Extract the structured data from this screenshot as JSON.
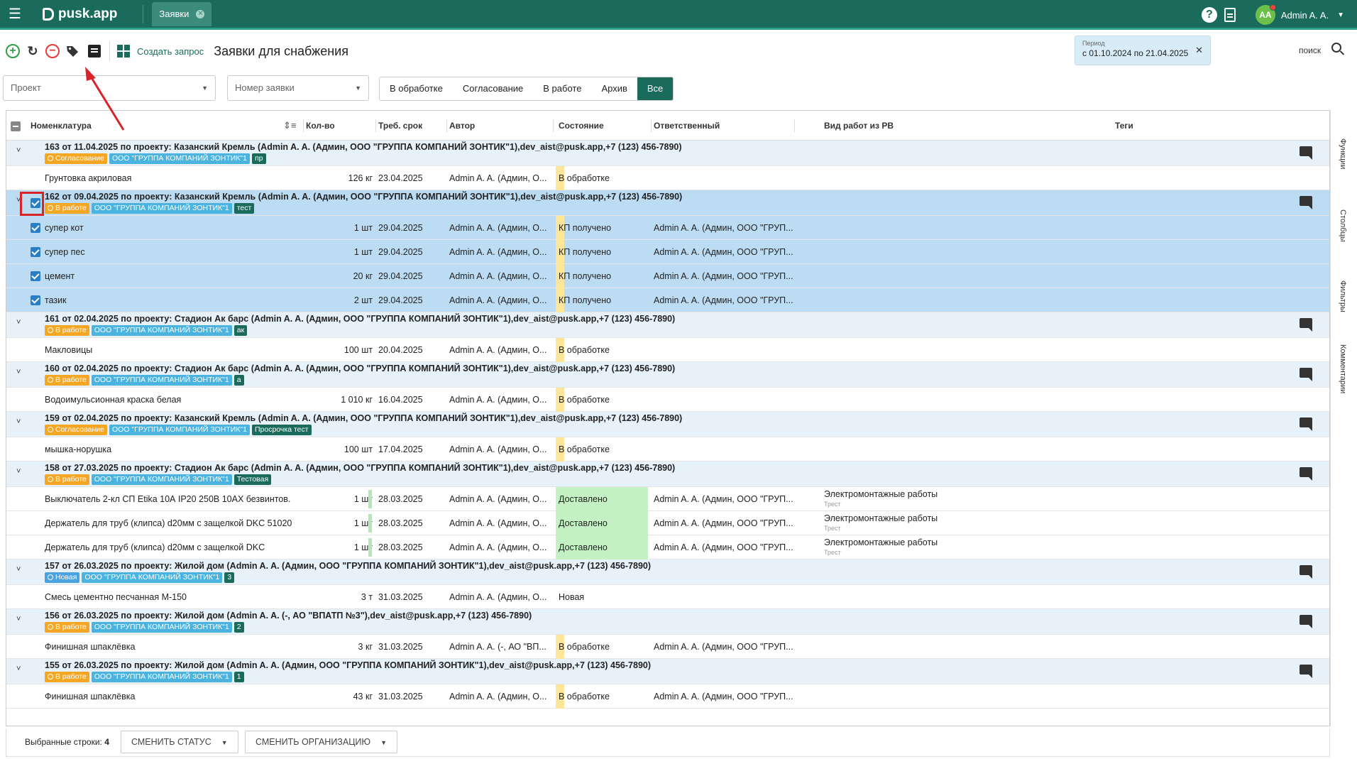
{
  "topbar": {
    "logo": "pusk.app",
    "tab": "Заявки",
    "avatar": "AA",
    "user": "Admin A. A."
  },
  "toolbar": {
    "create_label": "Создать запрос",
    "page_title": "Заявки для снабжения"
  },
  "period": {
    "label": "Период",
    "value": "с 01.10.2024 по 21.04.2025"
  },
  "search": {
    "label": "поиск"
  },
  "filters": {
    "project_placeholder": "Проект",
    "number_placeholder": "Номер заявки",
    "segments": [
      "В обработке",
      "Согласование",
      "В работе",
      "Архив",
      "Все"
    ],
    "active_segment": 4
  },
  "columns": {
    "name": "Номенклатура",
    "qty": "Кол-во",
    "due": "Треб. срок",
    "author": "Автор",
    "state": "Состояние",
    "resp": "Ответственный",
    "works": "Вид работ из РВ",
    "tags": "Теги"
  },
  "groups": [
    {
      "title": "163 от 11.04.2025 по проекту: Казанский Кремль (Admin A. A. (Админ, ООО \"ГРУППА КОМПАНИЙ ЗОНТИК\"1),dev_aist@pusk.app,+7 (123) 456-7890)",
      "status": "Согласование",
      "org": "ООО \"ГРУППА КОМПАНИЙ ЗОНТИК\"1",
      "tag": "пр"
    },
    {
      "title": "162 от 09.04.2025 по проекту: Казанский Кремль (Admin A. A. (Админ, ООО \"ГРУППА КОМПАНИЙ ЗОНТИК\"1),dev_aist@pusk.app,+7 (123) 456-7890)",
      "status": "В работе",
      "org": "ООО \"ГРУППА КОМПАНИЙ ЗОНТИК\"1",
      "tag": "тест"
    },
    {
      "title": "161 от 02.04.2025 по проекту: Стадион Ак барс (Admin A. A. (Админ, ООО \"ГРУППА КОМПАНИЙ ЗОНТИК\"1),dev_aist@pusk.app,+7 (123) 456-7890)",
      "status": "В работе",
      "org": "ООО \"ГРУППА КОМПАНИЙ ЗОНТИК\"1",
      "tag": "ак"
    },
    {
      "title": "160 от 02.04.2025 по проекту: Стадион Ак барс (Admin A. A. (Админ, ООО \"ГРУППА КОМПАНИЙ ЗОНТИК\"1),dev_aist@pusk.app,+7 (123) 456-7890)",
      "status": "В работе",
      "org": "ООО \"ГРУППА КОМПАНИЙ ЗОНТИК\"1",
      "tag": "а"
    },
    {
      "title": "159 от 02.04.2025 по проекту: Казанский Кремль (Admin A. A. (Админ, ООО \"ГРУППА КОМПАНИЙ ЗОНТИК\"1),dev_aist@pusk.app,+7 (123) 456-7890)",
      "status": "Согласование",
      "org": "ООО \"ГРУППА КОМПАНИЙ ЗОНТИК\"1",
      "tag": "Просрочка тест"
    },
    {
      "title": "158 от 27.03.2025 по проекту: Стадион Ак барс (Admin A. A. (Админ, ООО \"ГРУППА КОМПАНИЙ ЗОНТИК\"1),dev_aist@pusk.app,+7 (123) 456-7890)",
      "status": "В работе",
      "org": "ООО \"ГРУППА КОМПАНИЙ ЗОНТИК\"1",
      "tag": "Тестовая"
    },
    {
      "title": "157 от 26.03.2025 по проекту: Жилой дом (Admin A. A. (Админ, ООО \"ГРУППА КОМПАНИЙ ЗОНТИК\"1),dev_aist@pusk.app,+7 (123) 456-7890)",
      "status": "Новая",
      "org": "ООО \"ГРУППА КОМПАНИЙ ЗОНТИК\"1",
      "tag": "3"
    },
    {
      "title": "156 от 26.03.2025 по проекту: Жилой дом (Admin A. A. (-, АО \"ВПАТП №3\"),dev_aist@pusk.app,+7 (123) 456-7890)",
      "status": "В работе",
      "org": "ООО \"ГРУППА КОМПАНИЙ ЗОНТИК\"1",
      "tag": "2"
    },
    {
      "title": "155 от 26.03.2025 по проекту: Жилой дом (Admin A. A. (Админ, ООО \"ГРУППА КОМПАНИЙ ЗОНТИК\"1),dev_aist@pusk.app,+7 (123) 456-7890)",
      "status": "В работе",
      "org": "ООО \"ГРУППА КОМПАНИЙ ЗОНТИК\"1",
      "tag": "1"
    }
  ],
  "items": [
    {
      "name": "Грунтовка акриловая",
      "qty": "126 кг",
      "date": "23.04.2025",
      "author": "Admin A. A. (Админ, О...",
      "state": "В обработке",
      "resp": "",
      "works": "",
      "works_sub": ""
    },
    {
      "name": "супер кот",
      "qty": "1 шт",
      "date": "29.04.2025",
      "author": "Admin A. A. (Админ, О...",
      "state": "КП получено",
      "resp": "Admin A. A. (Админ, ООО \"ГРУП...",
      "works": "",
      "works_sub": ""
    },
    {
      "name": "супер пес",
      "qty": "1 шт",
      "date": "29.04.2025",
      "author": "Admin A. A. (Админ, О...",
      "state": "КП получено",
      "resp": "Admin A. A. (Админ, ООО \"ГРУП...",
      "works": "",
      "works_sub": ""
    },
    {
      "name": "цемент",
      "qty": "20 кг",
      "date": "29.04.2025",
      "author": "Admin A. A. (Админ, О...",
      "state": "КП получено",
      "resp": "Admin A. A. (Админ, ООО \"ГРУП...",
      "works": "",
      "works_sub": ""
    },
    {
      "name": "тазик",
      "qty": "2 шт",
      "date": "29.04.2025",
      "author": "Admin A. A. (Админ, О...",
      "state": "КП получено",
      "resp": "Admin A. A. (Админ, ООО \"ГРУП...",
      "works": "",
      "works_sub": ""
    },
    {
      "name": "Макловицы",
      "qty": "100 шт",
      "date": "20.04.2025",
      "author": "Admin A. A. (Админ, О...",
      "state": "В обработке",
      "resp": "",
      "works": "",
      "works_sub": ""
    },
    {
      "name": "Водоимульсионная краска белая",
      "qty": "1 010 кг",
      "date": "16.04.2025",
      "author": "Admin A. A. (Админ, О...",
      "state": "В обработке",
      "resp": "",
      "works": "",
      "works_sub": ""
    },
    {
      "name": "мышка-норушка",
      "qty": "100 шт",
      "date": "17.04.2025",
      "author": "Admin A. A. (Админ, О...",
      "state": "В обработке",
      "resp": "",
      "works": "",
      "works_sub": ""
    },
    {
      "name": "Выключатель 2-кл СП Etika 10А IP20 250В 10АХ безвинтов.",
      "qty": "1 шт",
      "date": "28.03.2025",
      "author": "Admin A. A. (Админ, О...",
      "state": "Доставлено",
      "resp": "Admin A. A. (Админ, ООО \"ГРУП...",
      "works": "Электромонтажные работы",
      "works_sub": "Трест"
    },
    {
      "name": "Держатель для труб (клипса) d20мм с защелкой DKC 51020",
      "qty": "1 шт",
      "date": "28.03.2025",
      "author": "Admin A. A. (Админ, О...",
      "state": "Доставлено",
      "resp": "Admin A. A. (Админ, ООО \"ГРУП...",
      "works": "Электромонтажные работы",
      "works_sub": "Трест"
    },
    {
      "name": "Держатель для труб (клипса) d20мм с защелкой DKC",
      "qty": "1 шт",
      "date": "28.03.2025",
      "author": "Admin A. A. (Админ, О...",
      "state": "Доставлено",
      "resp": "Admin A. A. (Админ, ООО \"ГРУП...",
      "works": "Электромонтажные работы",
      "works_sub": "Трест"
    },
    {
      "name": "Смесь цементно песчанная М-150",
      "qty": "3 т",
      "date": "31.03.2025",
      "author": "Admin A. A. (Админ, О...",
      "state": "Новая",
      "resp": "",
      "works": "",
      "works_sub": ""
    },
    {
      "name": "Финишная шпаклёвка",
      "qty": "3 кг",
      "date": "31.03.2025",
      "author": "Admin A. A. (-, АО \"ВП...",
      "state": "В обработке",
      "resp": "Admin A. A. (Админ, ООО \"ГРУП...",
      "works": "",
      "works_sub": ""
    },
    {
      "name": "Финишная шпаклёвка",
      "qty": "43 кг",
      "date": "31.03.2025",
      "author": "Admin A. A. (Админ, О...",
      "state": "В обработке",
      "resp": "Admin A. A. (Админ, ООО \"ГРУП...",
      "works": "",
      "works_sub": ""
    }
  ],
  "sidebar": {
    "functions": "Функции",
    "columns": "Столбцы",
    "filters": "Фильтры",
    "comments": "Комментарии"
  },
  "bottom": {
    "selected_label": "Выбранные строки:",
    "selected_count": "4",
    "change_status": "СМЕНИТЬ СТАТУС",
    "change_org": "СМЕНИТЬ ОРГАНИЗАЦИЮ"
  }
}
